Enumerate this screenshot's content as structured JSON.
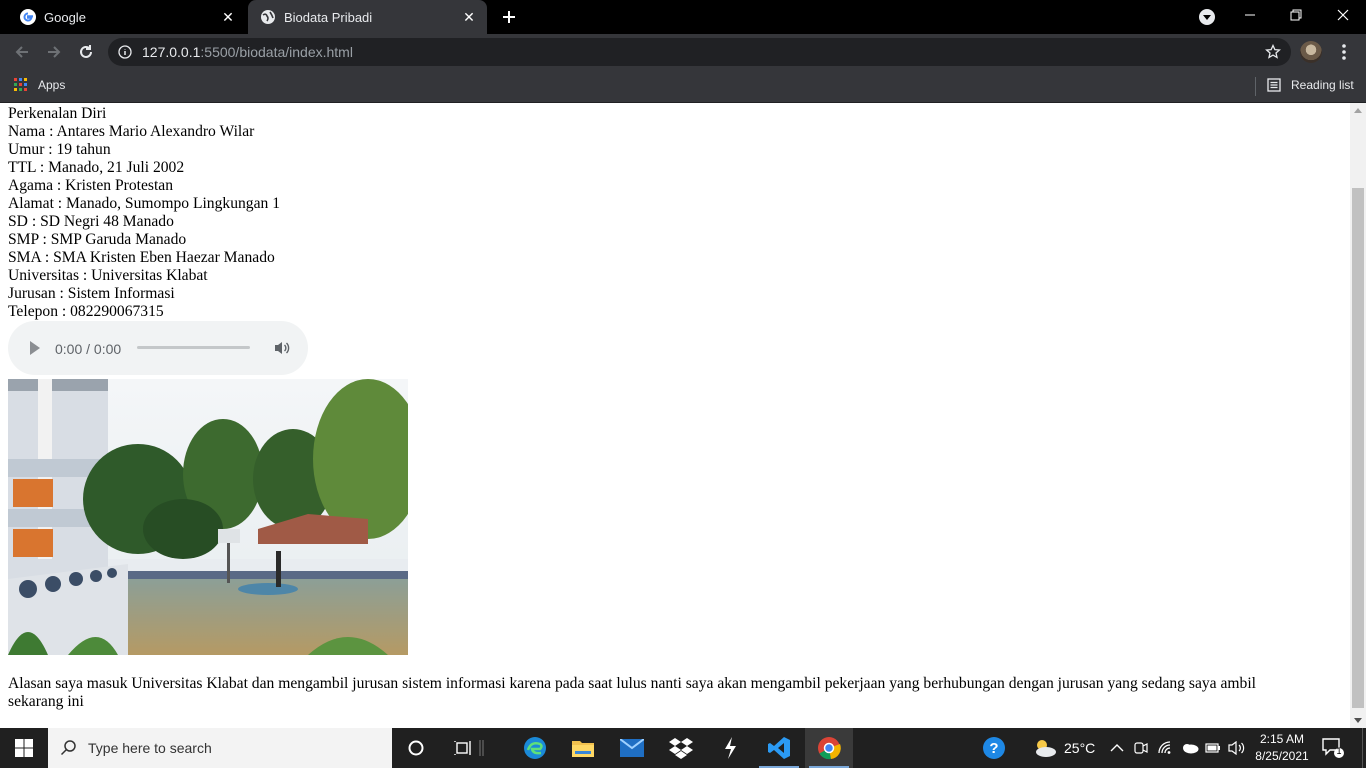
{
  "browser": {
    "tabs": [
      {
        "title": "Google",
        "active": false,
        "favicon": "google-icon"
      },
      {
        "title": "Biodata Pribadi",
        "active": true,
        "favicon": "globe-icon"
      }
    ],
    "url_host": "127.0.0.1",
    "url_rest": ":5500/biodata/index.html",
    "bookmarks": {
      "apps_label": "Apps",
      "reading_list_label": "Reading list"
    }
  },
  "page": {
    "lines": [
      "Perkenalan Diri",
      "Nama : Antares Mario Alexandro Wilar",
      "Umur : 19 tahun",
      "TTL : Manado, 21 Juli 2002",
      "Agama : Kristen Protestan",
      "Alamat : Manado, Sumompo Lingkungan 1",
      "SD : SD Negri 48 Manado",
      "SMP : SMP Garuda Manado",
      "SMA : SMA Kristen Eben Haezar Manado",
      "Universitas : Universitas Klabat",
      "Jurusan : Sistem Informasi",
      "Telepon : 082290067315"
    ],
    "audio": {
      "time": "0:00 / 0:00",
      "progress": 0
    },
    "photo_alt": "school-assembly-photo",
    "reason": "Alasan saya masuk Universitas Klabat dan mengambil jurusan sistem informasi karena pada saat lulus nanti saya akan mengambil pekerjaan yang berhubungan dengan jurusan yang sedang saya ambil sekarang ini"
  },
  "taskbar": {
    "search_placeholder": "Type here to search",
    "weather": "25°C",
    "time": "2:15 AM",
    "date": "8/25/2021",
    "notification_count": "1",
    "pinned": [
      "task-view-icon",
      "edge-icon",
      "file-explorer-icon",
      "mail-icon",
      "dropbox-icon",
      "app-icon",
      "vscode-icon",
      "chrome-icon"
    ]
  },
  "colors": {
    "tab_strip": "#000000",
    "toolbar": "#35363a",
    "omnibox": "#202124",
    "taskbar": "#202020",
    "accent": "#7aa7d8"
  }
}
